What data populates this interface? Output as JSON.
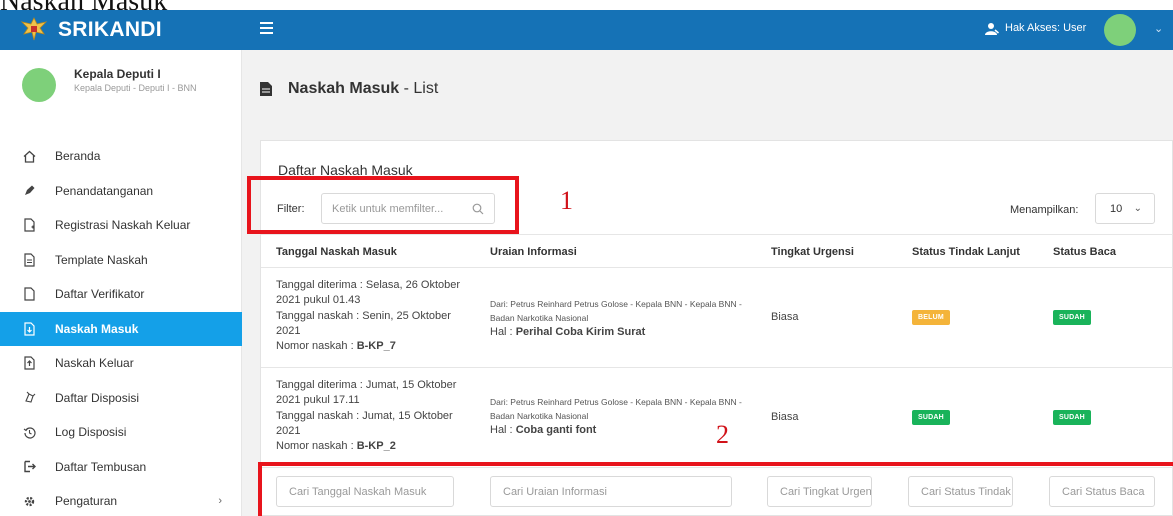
{
  "caption": "Naskah Masuk",
  "brand": {
    "name": "SRIKANDI"
  },
  "profile": {
    "name": "Kepala Deputi I",
    "role": "Kepala Deputi - Deputi I - BNN"
  },
  "sidebar": {
    "items": [
      {
        "label": "Beranda",
        "icon": "home-icon"
      },
      {
        "label": "Penandatanganan",
        "icon": "pen-icon"
      },
      {
        "label": "Registrasi Naskah Keluar",
        "icon": "file-plus-icon"
      },
      {
        "label": "Template Naskah",
        "icon": "file-text-icon"
      },
      {
        "label": "Daftar Verifikator",
        "icon": "file-icon"
      },
      {
        "label": "Naskah Masuk",
        "icon": "file-in-icon",
        "active": true
      },
      {
        "label": "Naskah Keluar",
        "icon": "file-out-icon"
      },
      {
        "label": "Daftar Disposisi",
        "icon": "share-icon"
      },
      {
        "label": "Log Disposisi",
        "icon": "history-icon"
      },
      {
        "label": "Daftar Tembusan",
        "icon": "forward-icon"
      },
      {
        "label": "Pengaturan",
        "icon": "gear-icon",
        "chevron": "›"
      }
    ]
  },
  "topbar": {
    "access": "Hak Akses: User",
    "chevron": "⌄"
  },
  "page": {
    "title_bold": "Naskah Masuk",
    "title_rest": " - List"
  },
  "card": {
    "title": "Daftar Naskah Masuk",
    "filter_label": "Filter:",
    "filter_placeholder": "Ketik untuk memfilter...",
    "show_label": "Menampilkan:",
    "show_value": "10"
  },
  "table": {
    "headers": [
      "Tanggal Naskah Masuk",
      "Uraian Informasi",
      "Tingkat Urgensi",
      "Status Tindak Lanjut",
      "Status Baca"
    ],
    "rows": [
      {
        "received": "Tanggal diterima : Selasa, 26 Oktober 2021 pukul 01.43",
        "date": "Tanggal naskah : Senin, 25 Oktober 2021",
        "number_label": "Nomor naskah : ",
        "number": "B-KP_7",
        "from": "Dari: Petrus Reinhard Petrus Golose - Kepala BNN - Kepala BNN - Badan Narkotika Nasional",
        "hal_label": "Hal : ",
        "hal": "Perihal Coba Kirim Surat",
        "urgency": "Biasa",
        "follow_up": "BELUM",
        "follow_up_color": "#f4b43a",
        "read": "SUDAH",
        "read_color": "#19b35a"
      },
      {
        "received": "Tanggal diterima : Jumat, 15 Oktober 2021 pukul 17.11",
        "date": "Tanggal naskah : Jumat, 15 Oktober 2021",
        "number_label": "Nomor naskah : ",
        "number": "B-KP_2",
        "from": "Dari: Petrus Reinhard Petrus Golose - Kepala BNN - Kepala BNN - Badan Narkotika Nasional",
        "hal_label": "Hal : ",
        "hal": "Coba ganti font",
        "urgency": "Biasa",
        "follow_up": "SUDAH",
        "follow_up_color": "#19b35a",
        "read": "SUDAH",
        "read_color": "#19b35a"
      }
    ],
    "search_placeholders": [
      "Cari Tanggal Naskah Masuk",
      "Cari Uraian Informasi",
      "Cari Tingkat Urgensi",
      "Cari Status Tindak Lanjut",
      "Cari Status Baca"
    ]
  },
  "annotations": {
    "one": "1",
    "two": "2",
    "color": "#e8141c"
  },
  "colors": {
    "topbar": "#1572b6",
    "active": "#14a0e8"
  }
}
